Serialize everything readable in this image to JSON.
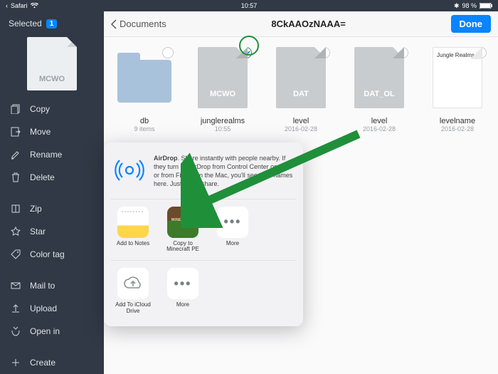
{
  "statusbar": {
    "app": "Safari",
    "time": "10:57",
    "battery": "98 %",
    "bt": "✱"
  },
  "sidebar": {
    "selected_label": "Selected",
    "selected_count": "1",
    "thumb_label": "MCWO",
    "items": [
      {
        "label": "Copy"
      },
      {
        "label": "Move"
      },
      {
        "label": "Rename"
      },
      {
        "label": "Delete"
      },
      {
        "label": "Zip"
      },
      {
        "label": "Star"
      },
      {
        "label": "Color tag"
      },
      {
        "label": "Mail to"
      },
      {
        "label": "Upload"
      },
      {
        "label": "Open in"
      },
      {
        "label": "Create"
      }
    ]
  },
  "topbar": {
    "back": "Documents",
    "title": "8CkAAOzNAAA=",
    "done": "Done"
  },
  "files": [
    {
      "kind": "folder",
      "name": "db",
      "meta": "9 items",
      "selected": false
    },
    {
      "kind": "doc",
      "tag": "MCWO",
      "name": "junglerealms",
      "meta": "10:55",
      "selected": true
    },
    {
      "kind": "doc",
      "tag": "DAT",
      "name": "level",
      "meta": "2016-02-28",
      "selected": false
    },
    {
      "kind": "doc",
      "tag": "DAT_OL",
      "name": "level",
      "meta": "2016-02-28",
      "selected": false
    },
    {
      "kind": "docwhite",
      "inner": "Jungle Realms",
      "name": "levelname",
      "meta": "2016-02-28",
      "selected": false
    }
  ],
  "share": {
    "airdrop_title": "AirDrop",
    "airdrop_body": ". Share instantly with people nearby. If they turn on AirDrop from Control Center on iOS or from Finder on the Mac, you'll see their names here. Just tap to share.",
    "row1": [
      {
        "label": "Add to Notes",
        "icon": "notes"
      },
      {
        "label": "Copy to Minecraft PE",
        "icon": "mc"
      },
      {
        "label": "More",
        "icon": "more"
      }
    ],
    "row2": [
      {
        "label": "Add To iCloud Drive",
        "icon": "cloud"
      },
      {
        "label": "More",
        "icon": "more"
      }
    ]
  }
}
